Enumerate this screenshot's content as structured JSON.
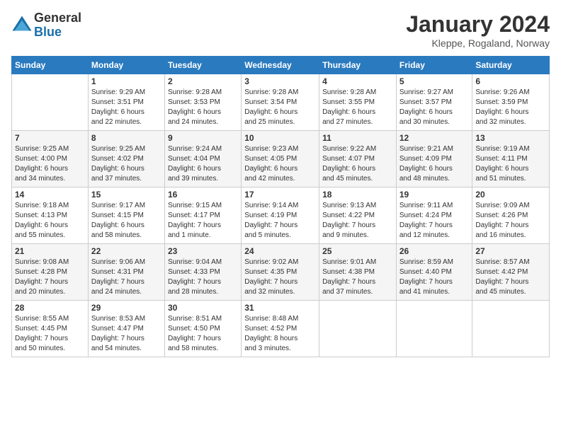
{
  "logo": {
    "general": "General",
    "blue": "Blue"
  },
  "header": {
    "month": "January 2024",
    "location": "Kleppe, Rogaland, Norway"
  },
  "days_of_week": [
    "Sunday",
    "Monday",
    "Tuesday",
    "Wednesday",
    "Thursday",
    "Friday",
    "Saturday"
  ],
  "weeks": [
    [
      {
        "day": "",
        "info": ""
      },
      {
        "day": "1",
        "info": "Sunrise: 9:29 AM\nSunset: 3:51 PM\nDaylight: 6 hours\nand 22 minutes."
      },
      {
        "day": "2",
        "info": "Sunrise: 9:28 AM\nSunset: 3:53 PM\nDaylight: 6 hours\nand 24 minutes."
      },
      {
        "day": "3",
        "info": "Sunrise: 9:28 AM\nSunset: 3:54 PM\nDaylight: 6 hours\nand 25 minutes."
      },
      {
        "day": "4",
        "info": "Sunrise: 9:28 AM\nSunset: 3:55 PM\nDaylight: 6 hours\nand 27 minutes."
      },
      {
        "day": "5",
        "info": "Sunrise: 9:27 AM\nSunset: 3:57 PM\nDaylight: 6 hours\nand 30 minutes."
      },
      {
        "day": "6",
        "info": "Sunrise: 9:26 AM\nSunset: 3:59 PM\nDaylight: 6 hours\nand 32 minutes."
      }
    ],
    [
      {
        "day": "7",
        "info": "Sunrise: 9:25 AM\nSunset: 4:00 PM\nDaylight: 6 hours\nand 34 minutes."
      },
      {
        "day": "8",
        "info": "Sunrise: 9:25 AM\nSunset: 4:02 PM\nDaylight: 6 hours\nand 37 minutes."
      },
      {
        "day": "9",
        "info": "Sunrise: 9:24 AM\nSunset: 4:04 PM\nDaylight: 6 hours\nand 39 minutes."
      },
      {
        "day": "10",
        "info": "Sunrise: 9:23 AM\nSunset: 4:05 PM\nDaylight: 6 hours\nand 42 minutes."
      },
      {
        "day": "11",
        "info": "Sunrise: 9:22 AM\nSunset: 4:07 PM\nDaylight: 6 hours\nand 45 minutes."
      },
      {
        "day": "12",
        "info": "Sunrise: 9:21 AM\nSunset: 4:09 PM\nDaylight: 6 hours\nand 48 minutes."
      },
      {
        "day": "13",
        "info": "Sunrise: 9:19 AM\nSunset: 4:11 PM\nDaylight: 6 hours\nand 51 minutes."
      }
    ],
    [
      {
        "day": "14",
        "info": "Sunrise: 9:18 AM\nSunset: 4:13 PM\nDaylight: 6 hours\nand 55 minutes."
      },
      {
        "day": "15",
        "info": "Sunrise: 9:17 AM\nSunset: 4:15 PM\nDaylight: 6 hours\nand 58 minutes."
      },
      {
        "day": "16",
        "info": "Sunrise: 9:15 AM\nSunset: 4:17 PM\nDaylight: 7 hours\nand 1 minute."
      },
      {
        "day": "17",
        "info": "Sunrise: 9:14 AM\nSunset: 4:19 PM\nDaylight: 7 hours\nand 5 minutes."
      },
      {
        "day": "18",
        "info": "Sunrise: 9:13 AM\nSunset: 4:22 PM\nDaylight: 7 hours\nand 9 minutes."
      },
      {
        "day": "19",
        "info": "Sunrise: 9:11 AM\nSunset: 4:24 PM\nDaylight: 7 hours\nand 12 minutes."
      },
      {
        "day": "20",
        "info": "Sunrise: 9:09 AM\nSunset: 4:26 PM\nDaylight: 7 hours\nand 16 minutes."
      }
    ],
    [
      {
        "day": "21",
        "info": "Sunrise: 9:08 AM\nSunset: 4:28 PM\nDaylight: 7 hours\nand 20 minutes."
      },
      {
        "day": "22",
        "info": "Sunrise: 9:06 AM\nSunset: 4:31 PM\nDaylight: 7 hours\nand 24 minutes."
      },
      {
        "day": "23",
        "info": "Sunrise: 9:04 AM\nSunset: 4:33 PM\nDaylight: 7 hours\nand 28 minutes."
      },
      {
        "day": "24",
        "info": "Sunrise: 9:02 AM\nSunset: 4:35 PM\nDaylight: 7 hours\nand 32 minutes."
      },
      {
        "day": "25",
        "info": "Sunrise: 9:01 AM\nSunset: 4:38 PM\nDaylight: 7 hours\nand 37 minutes."
      },
      {
        "day": "26",
        "info": "Sunrise: 8:59 AM\nSunset: 4:40 PM\nDaylight: 7 hours\nand 41 minutes."
      },
      {
        "day": "27",
        "info": "Sunrise: 8:57 AM\nSunset: 4:42 PM\nDaylight: 7 hours\nand 45 minutes."
      }
    ],
    [
      {
        "day": "28",
        "info": "Sunrise: 8:55 AM\nSunset: 4:45 PM\nDaylight: 7 hours\nand 50 minutes."
      },
      {
        "day": "29",
        "info": "Sunrise: 8:53 AM\nSunset: 4:47 PM\nDaylight: 7 hours\nand 54 minutes."
      },
      {
        "day": "30",
        "info": "Sunrise: 8:51 AM\nSunset: 4:50 PM\nDaylight: 7 hours\nand 58 minutes."
      },
      {
        "day": "31",
        "info": "Sunrise: 8:48 AM\nSunset: 4:52 PM\nDaylight: 8 hours\nand 3 minutes."
      },
      {
        "day": "",
        "info": ""
      },
      {
        "day": "",
        "info": ""
      },
      {
        "day": "",
        "info": ""
      }
    ]
  ]
}
